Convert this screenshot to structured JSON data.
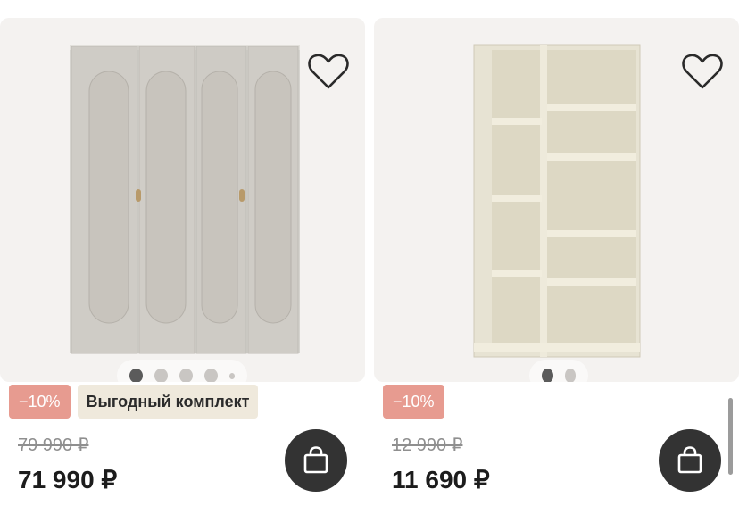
{
  "products": [
    {
      "discount_badge": "−10%",
      "promo_badge": "Выгодный комплект",
      "old_price": "79 990 ₽",
      "price": "71 990 ₽",
      "image": "wardrobe-photo",
      "carousel_total": 5,
      "carousel_active": 1
    },
    {
      "discount_badge": "−10%",
      "old_price": "12 990 ₽",
      "price": "11 690 ₽",
      "image": "bookshelf-photo",
      "carousel_total": 2,
      "carousel_active": 1
    }
  ],
  "colors": {
    "discount": "#e79b90",
    "promo": "#efe9dc",
    "cart_button": "#333333",
    "card_bg": "#f4f2f0"
  },
  "icons": [
    "heart-icon",
    "shopping-bag-icon"
  ]
}
